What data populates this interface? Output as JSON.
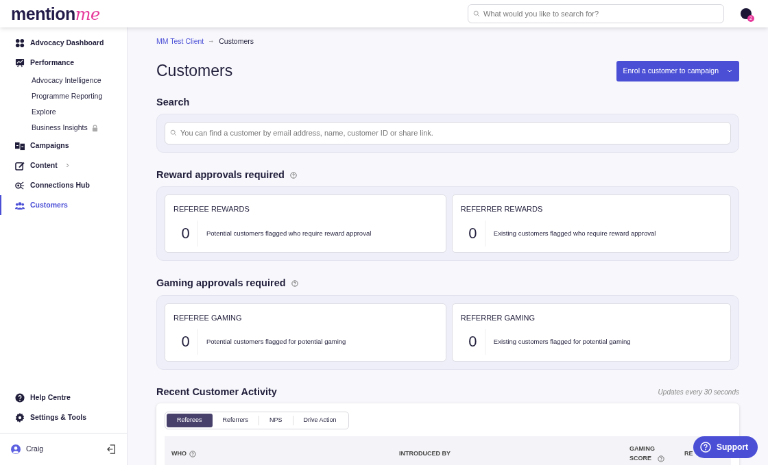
{
  "logo": {
    "main": "mention",
    "accent": "me"
  },
  "header": {
    "search": {
      "placeholder": "What would you like to search for?"
    },
    "notification_count": "2"
  },
  "sidebar": {
    "items": [
      {
        "label": "Advocacy Dashboard",
        "selected": false
      },
      {
        "label": "Performance",
        "selected": false,
        "children": [
          {
            "label": "Advocacy Intelligence",
            "selected": false,
            "locked": false
          },
          {
            "label": "Programme Reporting",
            "selected": false,
            "locked": false
          },
          {
            "label": "Explore",
            "selected": false,
            "locked": false
          },
          {
            "label": "Business Insights",
            "selected": false,
            "locked": true
          }
        ]
      },
      {
        "label": "Campaigns",
        "selected": false
      },
      {
        "label": "Content",
        "selected": false,
        "has_submenu": true
      },
      {
        "label": "Connections Hub",
        "selected": false
      },
      {
        "label": "Customers",
        "selected": true
      }
    ],
    "bottom_items": [
      {
        "label": "Help Centre"
      },
      {
        "label": "Settings & Tools"
      }
    ],
    "user": {
      "name": "Craig"
    }
  },
  "breadcrumb": [
    "MM Test Client",
    "Customers"
  ],
  "page_title": "Customers",
  "enrol_button": "Enrol a customer to campaign",
  "search_section": {
    "title": "Search",
    "placeholder": "You can find a customer by email address, name, customer ID or share link."
  },
  "approval_sections": [
    {
      "title": "Reward approvals required",
      "cards": [
        {
          "title": "REFEREE REWARDS",
          "count": "0",
          "description": "Potential customers flagged who require reward approval"
        },
        {
          "title": "REFERRER REWARDS",
          "count": "0",
          "description": "Existing customers flagged who require reward approval"
        }
      ]
    },
    {
      "title": "Gaming approvals required",
      "cards": [
        {
          "title": "REFEREE GAMING",
          "count": "0",
          "description": "Potential customers flagged for potential gaming"
        },
        {
          "title": "REFERRER GAMING",
          "count": "0",
          "description": "Existing customers flagged for potential gaming"
        }
      ]
    }
  ],
  "activity": {
    "title": "Recent Customer Activity",
    "note": "Updates every 30 seconds",
    "tabs": [
      {
        "label": "Referees",
        "selected": true
      },
      {
        "label": "Referrers",
        "selected": false
      },
      {
        "label": "NPS",
        "selected": false
      },
      {
        "label": "Drive Action",
        "selected": false
      }
    ],
    "table": {
      "columns": [
        {
          "label": "WHO",
          "help": true
        },
        {
          "label": "INTRODUCED BY"
        },
        {
          "label": "GAMING SCORE",
          "help": true
        },
        {
          "label": "RE"
        }
      ]
    }
  },
  "support_button": "Support"
}
